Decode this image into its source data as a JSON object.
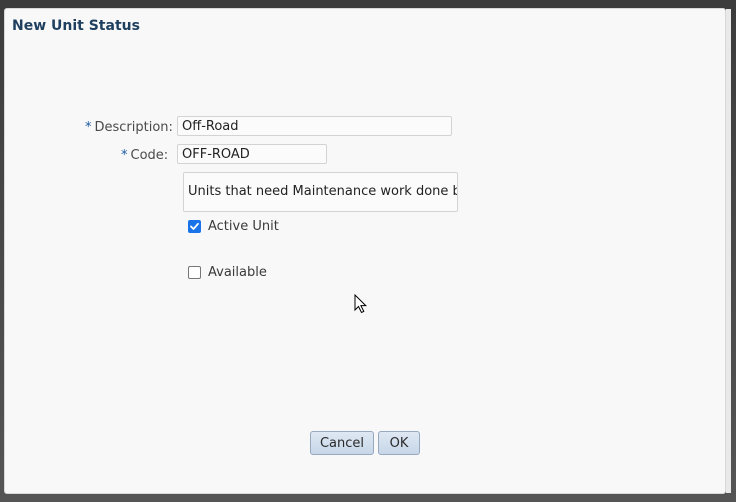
{
  "dialog": {
    "title": "New Unit Status"
  },
  "form": {
    "required_marker": "*",
    "description": {
      "label": "Description:",
      "value": "Off-Road"
    },
    "code": {
      "label": "Code:",
      "value": "OFF-ROAD"
    },
    "notes": {
      "value": "Units that need Maintenance work done befo"
    },
    "active_unit": {
      "label": "Active Unit",
      "checked": true
    },
    "available": {
      "label": "Available",
      "checked": false
    }
  },
  "buttons": {
    "cancel": "Cancel",
    "ok": "OK"
  },
  "colors": {
    "title": "#1f3f5f",
    "required": "#1a5aa0",
    "checkbox_checked": "#1a73e8"
  },
  "icons": {
    "cursor": "mouse-pointer-icon",
    "check": "checkmark-icon"
  }
}
